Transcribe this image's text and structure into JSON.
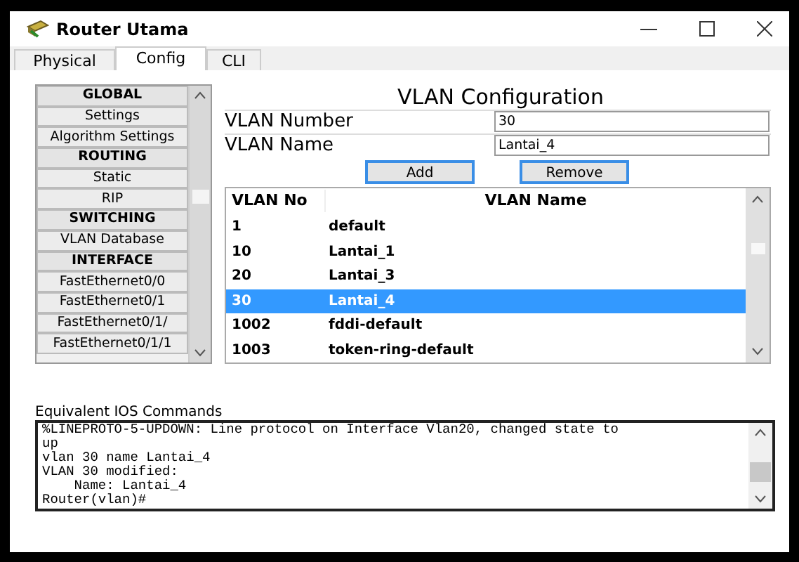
{
  "window": {
    "title": "Router Utama"
  },
  "tabs": [
    {
      "label": "Physical",
      "selected": false
    },
    {
      "label": "Config",
      "selected": true
    },
    {
      "label": "CLI",
      "selected": false
    }
  ],
  "sidebar": {
    "items": [
      {
        "kind": "header",
        "label": "GLOBAL"
      },
      {
        "kind": "item",
        "label": "Settings"
      },
      {
        "kind": "item",
        "label": "Algorithm Settings"
      },
      {
        "kind": "header",
        "label": "ROUTING"
      },
      {
        "kind": "item",
        "label": "Static"
      },
      {
        "kind": "item",
        "label": "RIP"
      },
      {
        "kind": "header",
        "label": "SWITCHING"
      },
      {
        "kind": "item",
        "label": "VLAN Database"
      },
      {
        "kind": "header",
        "label": "INTERFACE"
      },
      {
        "kind": "item",
        "label": "FastEthernet0/0"
      },
      {
        "kind": "item",
        "label": "FastEthernet0/1"
      },
      {
        "kind": "item",
        "label": "FastEthernet0/1/"
      },
      {
        "kind": "item",
        "label": "FastEthernet0/1/1"
      }
    ]
  },
  "panel": {
    "title": "VLAN Configuration",
    "fields": [
      {
        "label": "VLAN Number",
        "value": "30"
      },
      {
        "label": "VLAN Name",
        "value": "Lantai_4"
      }
    ],
    "buttons": [
      "Add",
      "Remove"
    ],
    "table": {
      "columns": [
        "VLAN No",
        "VLAN Name"
      ],
      "rows": [
        {
          "cells": [
            "1",
            "default"
          ],
          "selected": false
        },
        {
          "cells": [
            "10",
            "Lantai_1"
          ],
          "selected": false
        },
        {
          "cells": [
            "20",
            "Lantai_3"
          ],
          "selected": false
        },
        {
          "cells": [
            "30",
            "Lantai_4"
          ],
          "selected": true
        },
        {
          "cells": [
            "1002",
            "fddi-default"
          ],
          "selected": false
        },
        {
          "cells": [
            "1003",
            "token-ring-default"
          ],
          "selected": false
        }
      ]
    }
  },
  "ios": {
    "label": "Equivalent IOS Commands",
    "lines": [
      "%LINEPROTO-5-UPDOWN: Line protocol on Interface Vlan20, changed state to",
      "up",
      "vlan 30 name Lantai_4",
      "VLAN 30 modified:",
      "    Name: Lantai_4",
      "Router(vlan)#"
    ]
  }
}
